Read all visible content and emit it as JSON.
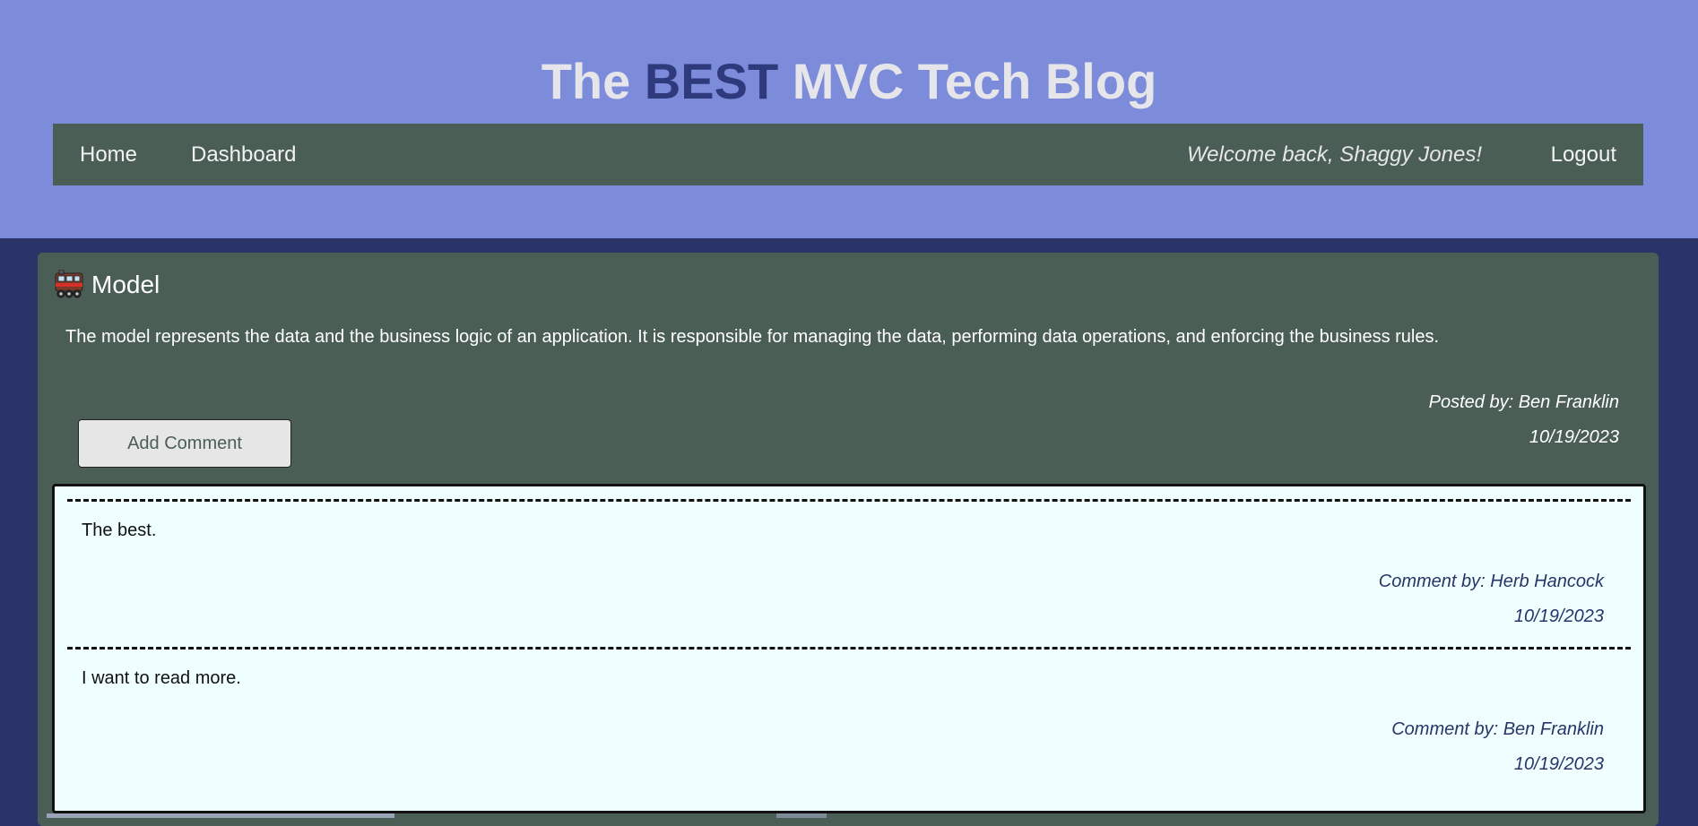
{
  "header": {
    "title_prefix": "The ",
    "title_accent": "BEST",
    "title_suffix": " MVC Tech Blog",
    "colors": {
      "header_bg": "#7d8bdb",
      "title": "#e6e6ea",
      "accent": "#2f3a7d",
      "page_bg": "#2a3468"
    }
  },
  "nav": {
    "home_label": "Home",
    "dashboard_label": "Dashboard",
    "welcome_text": "Welcome back, Shaggy Jones!",
    "logout_label": "Logout",
    "bg": "#4a5e56"
  },
  "post": {
    "icon": "train-icon",
    "title": "Model",
    "body": "The model represents the data and the business logic of an application. It is responsible for managing the data, performing data operations, and enforcing the business rules.",
    "posted_by": "Posted by: Ben Franklin",
    "date": "10/19/2023",
    "add_comment_label": "Add Comment"
  },
  "comments": [
    {
      "text": "The best.",
      "author_line": "Comment by: Herb Hancock",
      "date": "10/19/2023"
    },
    {
      "text": "I want to read more.",
      "author_line": "Comment by: Ben Franklin",
      "date": "10/19/2023"
    }
  ]
}
